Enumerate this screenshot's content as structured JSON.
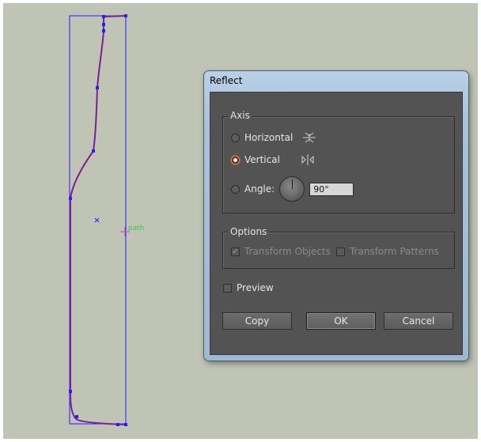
{
  "canvas": {
    "path_label": "path"
  },
  "dialog": {
    "title": "Reflect",
    "axis": {
      "label": "Axis",
      "horizontal_label": "Horizontal",
      "vertical_label": "Vertical",
      "selected": "vertical",
      "angle_label": "Angle:",
      "angle_value": "90°"
    },
    "options": {
      "label": "Options",
      "transform_objects_label": "Transform Objects",
      "transform_objects_checked": true,
      "transform_patterns_label": "Transform Patterns",
      "transform_patterns_checked": false
    },
    "preview_label": "Preview",
    "preview_checked": false,
    "buttons": {
      "copy": "Copy",
      "ok": "OK",
      "cancel": "Cancel"
    }
  },
  "colors": {
    "canvas_bg": "#bfc4b5",
    "selection_blue": "#2020ff",
    "path_red": "#c8102e",
    "path_label_green": "#3ccf3c",
    "dialog_panel": "#535353"
  },
  "icons": {
    "horizontal_reflect": "reflect-horizontal-icon",
    "vertical_reflect": "reflect-vertical-icon"
  }
}
